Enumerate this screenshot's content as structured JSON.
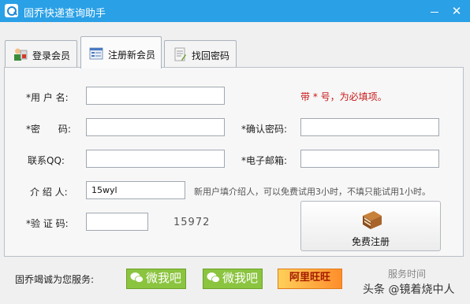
{
  "window": {
    "title": "固乔快递查询助手",
    "minimize_glyph": "",
    "close_glyph": "✕"
  },
  "tabs": [
    {
      "label": "登录会员",
      "icon": "user-login-icon"
    },
    {
      "label": "注册新会员",
      "icon": "register-form-icon",
      "active": true
    },
    {
      "label": "找回密码",
      "icon": "password-recovery-icon"
    }
  ],
  "form": {
    "username_label": "*用 户 名:",
    "password_label": "*密      码:",
    "confirm_label": "*确认密码:",
    "qq_label": "联系QQ:",
    "email_label": "*电子邮箱:",
    "referrer_label": "介 绍 人:",
    "referrer_value": "15wyl",
    "captcha_label": "*验 证 码:",
    "captcha_code": "15972",
    "required_hint": "带 * 号，为必填项。",
    "referrer_hint": "新用户填介绍人，可以免费试用3小时，不填只能试用1小时。",
    "register_button": "免费注册"
  },
  "footer": {
    "service_label": "固乔竭诚为您服务:",
    "wechat1": "微我吧",
    "wechat2": "微我吧",
    "ad_text": "阿里旺旺",
    "service_time": "服务时间",
    "watermark": "头条 @镜着烧中人"
  },
  "colors": {
    "titlebar": "#2aa0e6",
    "required_hint": "#c81818",
    "wechat_green": "#8bc43f"
  }
}
